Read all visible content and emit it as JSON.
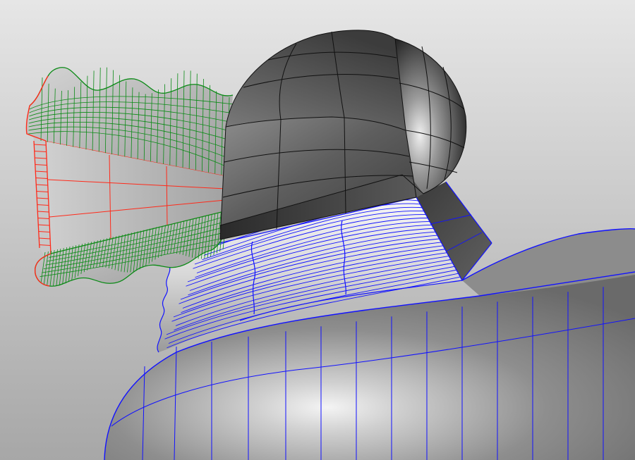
{
  "viewport": {
    "background_top": "#e6e6e6",
    "background_bottom": "#a7a7a7"
  },
  "colors": {
    "wire_red": "#ff2a1a",
    "wire_green": "#0b8a16",
    "wire_blue": "#1212ff",
    "iso_dark": "#111111",
    "shade_light": "#f2f2f2",
    "shade_dark": "#2c2c2c"
  },
  "objects": [
    {
      "id": "base-dome",
      "kind": "surface",
      "wireframe": "blue"
    },
    {
      "id": "fluted-molding",
      "kind": "surface",
      "wireframe": "blue"
    },
    {
      "id": "wavy-fringe-upper",
      "kind": "surface",
      "wireframe": "green"
    },
    {
      "id": "wavy-fringe-lower",
      "kind": "surface",
      "wireframe": "green"
    },
    {
      "id": "edge-rim",
      "kind": "surface",
      "wireframe": "red"
    },
    {
      "id": "rounded-head",
      "kind": "polysurface",
      "wireframe": "black"
    }
  ]
}
